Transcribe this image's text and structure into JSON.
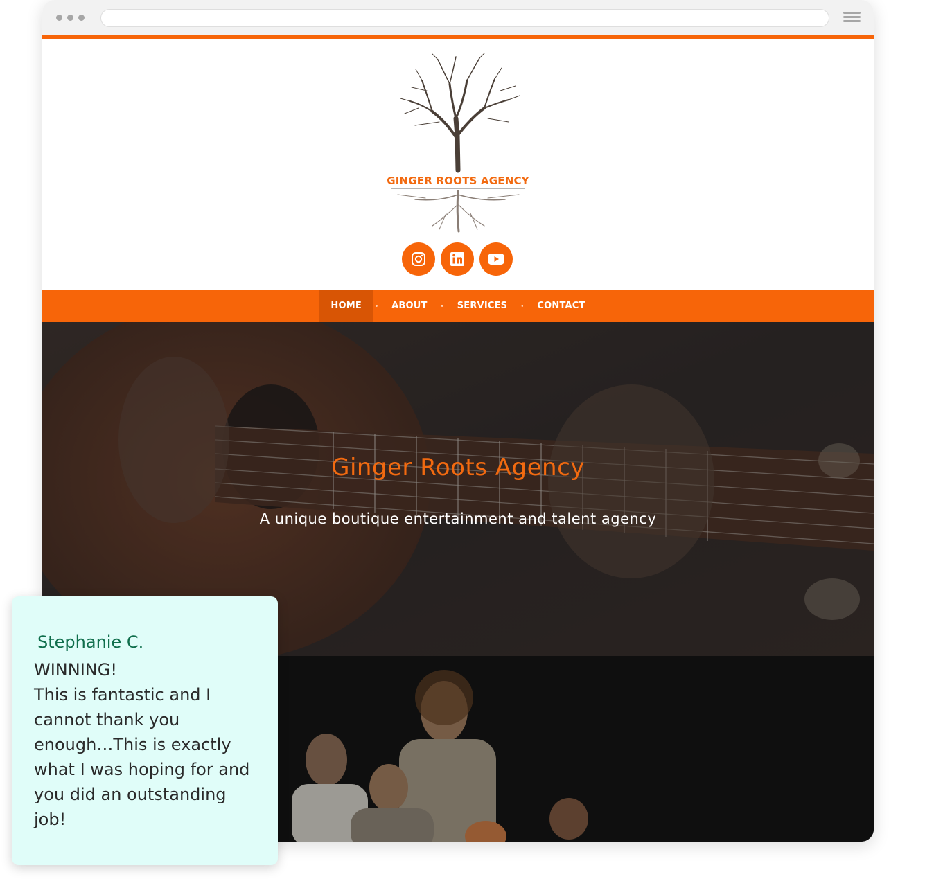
{
  "colors": {
    "accent": "#f76509",
    "nav_active": "#d85505",
    "hero_title": "#f26a10",
    "testimonial_bg": "#e0fdf9",
    "testimonial_name": "#0f6e4c"
  },
  "browser": {
    "menu_icon": "hamburger-icon"
  },
  "header": {
    "logo_text": "GINGER ROOTS AGENCY",
    "socials": [
      {
        "icon": "instagram-icon"
      },
      {
        "icon": "linkedin-icon"
      },
      {
        "icon": "youtube-icon"
      }
    ]
  },
  "nav": {
    "items": [
      {
        "label": "HOME",
        "active": true
      },
      {
        "label": "ABOUT",
        "active": false
      },
      {
        "label": "SERVICES",
        "active": false
      },
      {
        "label": "CONTACT",
        "active": false
      }
    ]
  },
  "hero": {
    "title": "Ginger Roots Agency",
    "subtitle": "A unique boutique entertainment and talent agency"
  },
  "testimonial": {
    "name": "Stephanie C.",
    "lines": [
      "WINNING!",
      "This is fantastic and I",
      "cannot thank you",
      "enough…This is exactly",
      "what I was hoping for and",
      "you did an outstanding",
      "job!"
    ]
  }
}
